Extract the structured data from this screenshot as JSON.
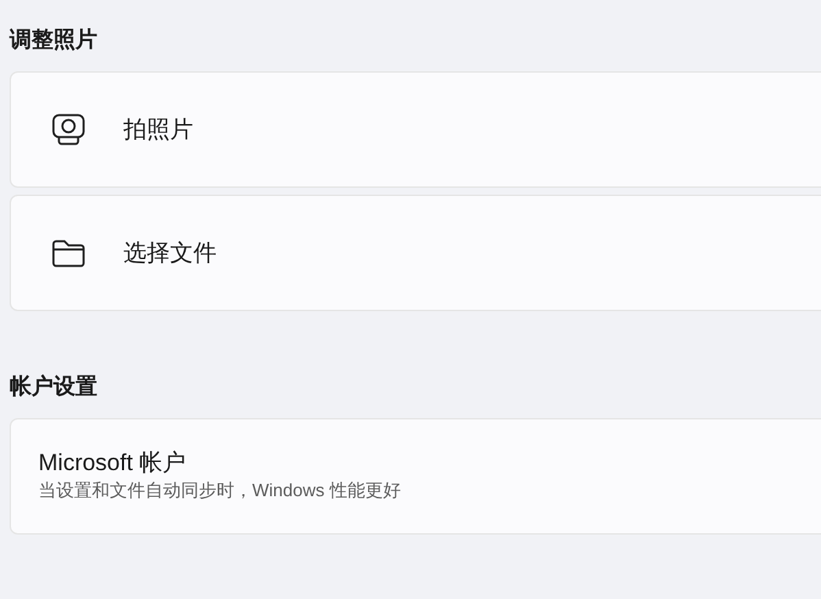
{
  "sections": [
    {
      "heading": "调整照片",
      "items": [
        {
          "kind": "camera",
          "label": "拍照片"
        },
        {
          "kind": "folder",
          "label": "选择文件"
        }
      ]
    },
    {
      "heading": "帐户设置",
      "items": [
        {
          "kind": "info",
          "title": "Microsoft 帐户",
          "description": "当设置和文件自动同步时，Windows 性能更好"
        }
      ]
    }
  ]
}
